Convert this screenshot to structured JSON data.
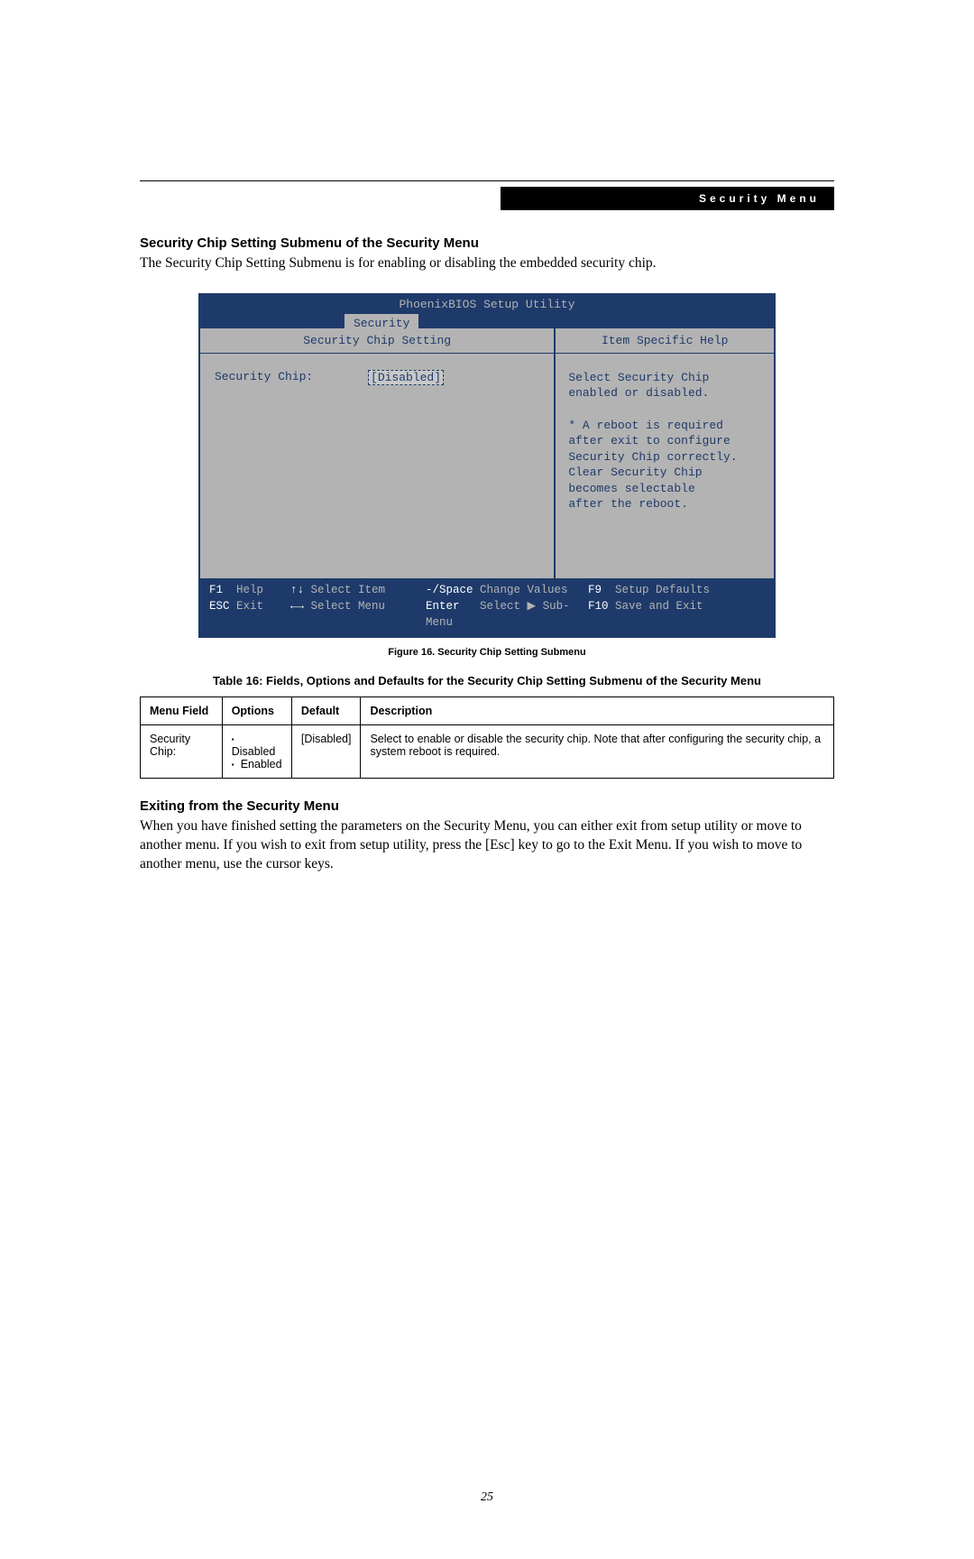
{
  "header": {
    "banner": "Security Menu"
  },
  "section1": {
    "title": "Security Chip Setting Submenu of the Security Menu",
    "body": "The Security Chip Setting Submenu is for enabling or disabling the embedded security chip."
  },
  "bios": {
    "title": "PhoenixBIOS Setup Utility",
    "tab": "Security",
    "left_heading": "Security Chip Setting",
    "right_heading": "Item Specific Help",
    "field_label": "Security Chip:",
    "field_value": "Disabled",
    "help_text_lines": [
      "Select Security Chip",
      "enabled or disabled.",
      "",
      "* A reboot is required",
      "after exit to configure",
      "Security Chip correctly.",
      "Clear Security Chip",
      "becomes selectable",
      "after the reboot."
    ],
    "footer": {
      "r1": {
        "k1": "F1",
        "t1": "Help",
        "k2": "↑↓",
        "t2": "Select Item",
        "k3": "-/Space",
        "t3": "Change Values",
        "k4": "F9",
        "t4": "Setup Defaults"
      },
      "r2": {
        "k1": "ESC",
        "t1": "Exit",
        "k2": "←→",
        "t2": "Select Menu",
        "k3": "Enter",
        "t3": "Select ▶ Sub-Menu",
        "k4": "F10",
        "t4": "Save and Exit"
      }
    }
  },
  "figure_caption": "Figure 16.   Security Chip Setting Submenu",
  "table_caption": "Table 16: Fields, Options and Defaults for the Security Chip Setting Submenu of the Security Menu",
  "table": {
    "headers": [
      "Menu Field",
      "Options",
      "Default",
      "Description"
    ],
    "rows": [
      {
        "menu_field": "Security Chip:",
        "options": [
          "Disabled",
          "Enabled"
        ],
        "default": "[Disabled]",
        "description": "Select to enable or disable the security chip. Note that after configuring the security chip, a system reboot is required."
      }
    ]
  },
  "section2": {
    "title": "Exiting from the Security Menu",
    "body": "When you have finished setting the parameters on the Security Menu, you can either exit from setup utility or move to another menu. If you wish to exit from setup utility, press the [Esc] key to go to the Exit Menu. If you wish to move to another menu, use the cursor keys."
  },
  "page_number": "25",
  "chart_data": {
    "type": "table",
    "title": "Fields, Options and Defaults for the Security Chip Setting Submenu of the Security Menu",
    "columns": [
      "Menu Field",
      "Options",
      "Default",
      "Description"
    ],
    "rows": [
      [
        "Security Chip:",
        "Disabled; Enabled",
        "[Disabled]",
        "Select to enable or disable the security chip. Note that after configuring the security chip, a system reboot is required."
      ]
    ]
  }
}
